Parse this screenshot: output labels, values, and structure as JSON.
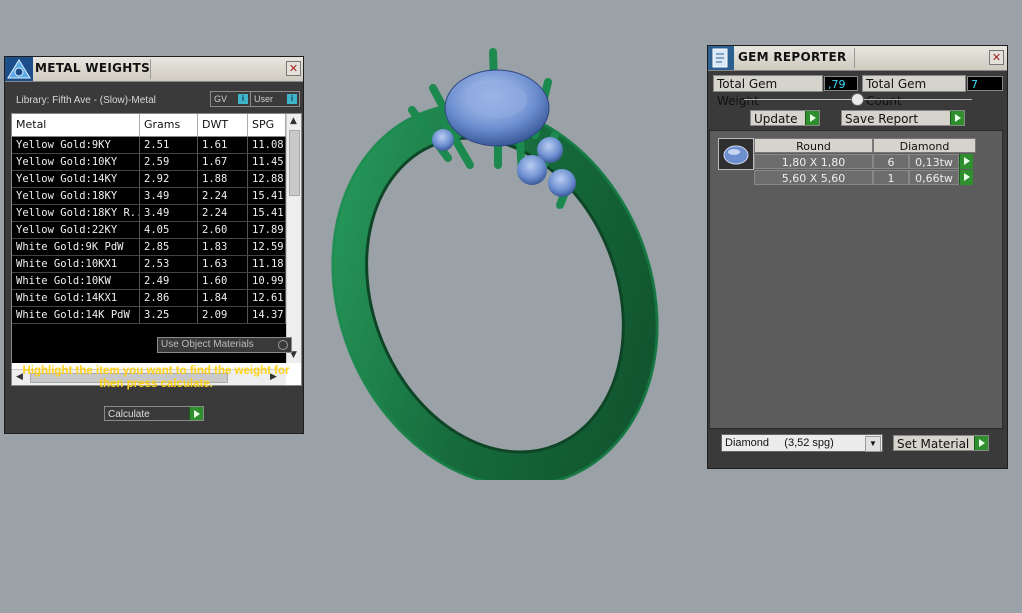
{
  "metal_weights": {
    "title": "METAL WEIGHTS",
    "library_label": "Library: Fifth Ave - (Slow)-Metal",
    "gv_label": "GV",
    "user_label": "User",
    "columns": [
      "Metal",
      "Grams",
      "DWT",
      "SPG"
    ],
    "rows": [
      [
        "Yellow Gold:9KY",
        "2.51",
        "1.61",
        "11.08"
      ],
      [
        "Yellow Gold:10KY",
        "2.59",
        "1.67",
        "11.45"
      ],
      [
        "Yellow Gold:14KY",
        "2.92",
        "1.88",
        "12.88"
      ],
      [
        "Yellow Gold:18KY",
        "3.49",
        "2.24",
        "15.41"
      ],
      [
        "Yellow Gold:18KY R...",
        "3.49",
        "2.24",
        "15.41"
      ],
      [
        "Yellow Gold:22KY",
        "4.05",
        "2.60",
        "17.89"
      ],
      [
        "White Gold:9K PdW",
        "2.85",
        "1.83",
        "12.59"
      ],
      [
        "White Gold:10KX1",
        "2.53",
        "1.63",
        "11.18"
      ],
      [
        "White Gold:10KW",
        "2.49",
        "1.60",
        "10.99"
      ],
      [
        "White Gold:14KX1",
        "2.86",
        "1.84",
        "12.61"
      ],
      [
        "White Gold:14K PdW",
        "3.25",
        "2.09",
        "14.37"
      ]
    ],
    "use_object_materials": "Use Object Materials",
    "hint": "Highlight the item you want to find the weight for then press calculate.",
    "calculate_label": "Calculate"
  },
  "gem_reporter": {
    "title": "GEM REPORTER",
    "total_weight_label": "Total Gem Weight",
    "total_weight_value": ",79",
    "total_count_label": "Total Gem Count",
    "total_count_value": "7",
    "update_label": "Update",
    "save_report_label": "Save Report",
    "table_headers": [
      "Round",
      "Diamond"
    ],
    "gems": [
      {
        "size": "1,80 X 1,80",
        "count": "6",
        "weight": "0,13tw"
      },
      {
        "size": "5,60 X 5,60",
        "count": "1",
        "weight": "0,66tw"
      }
    ],
    "material_select": "Diamond     (3,52 spg)",
    "set_material_label": "Set Material"
  },
  "colors": {
    "ring_metal": "#1f7a4a",
    "gem_blue": "#6d8fd0",
    "value_cyan": "#40d8ff",
    "hint_yellow": "#ffd21a",
    "go_green": "#2f8f2f"
  }
}
